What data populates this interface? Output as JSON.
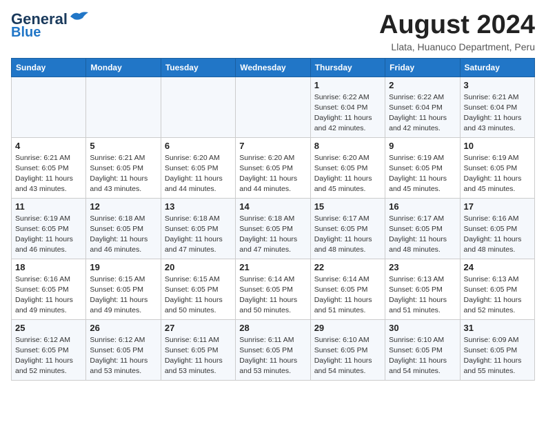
{
  "header": {
    "logo_line1": "General",
    "logo_line2": "Blue",
    "month": "August 2024",
    "location": "Llata, Huanuco Department, Peru"
  },
  "days_of_week": [
    "Sunday",
    "Monday",
    "Tuesday",
    "Wednesday",
    "Thursday",
    "Friday",
    "Saturday"
  ],
  "weeks": [
    [
      {
        "day": "",
        "info": ""
      },
      {
        "day": "",
        "info": ""
      },
      {
        "day": "",
        "info": ""
      },
      {
        "day": "",
        "info": ""
      },
      {
        "day": "1",
        "info": "Sunrise: 6:22 AM\nSunset: 6:04 PM\nDaylight: 11 hours\nand 42 minutes."
      },
      {
        "day": "2",
        "info": "Sunrise: 6:22 AM\nSunset: 6:04 PM\nDaylight: 11 hours\nand 42 minutes."
      },
      {
        "day": "3",
        "info": "Sunrise: 6:21 AM\nSunset: 6:04 PM\nDaylight: 11 hours\nand 43 minutes."
      }
    ],
    [
      {
        "day": "4",
        "info": "Sunrise: 6:21 AM\nSunset: 6:05 PM\nDaylight: 11 hours\nand 43 minutes."
      },
      {
        "day": "5",
        "info": "Sunrise: 6:21 AM\nSunset: 6:05 PM\nDaylight: 11 hours\nand 43 minutes."
      },
      {
        "day": "6",
        "info": "Sunrise: 6:20 AM\nSunset: 6:05 PM\nDaylight: 11 hours\nand 44 minutes."
      },
      {
        "day": "7",
        "info": "Sunrise: 6:20 AM\nSunset: 6:05 PM\nDaylight: 11 hours\nand 44 minutes."
      },
      {
        "day": "8",
        "info": "Sunrise: 6:20 AM\nSunset: 6:05 PM\nDaylight: 11 hours\nand 45 minutes."
      },
      {
        "day": "9",
        "info": "Sunrise: 6:19 AM\nSunset: 6:05 PM\nDaylight: 11 hours\nand 45 minutes."
      },
      {
        "day": "10",
        "info": "Sunrise: 6:19 AM\nSunset: 6:05 PM\nDaylight: 11 hours\nand 45 minutes."
      }
    ],
    [
      {
        "day": "11",
        "info": "Sunrise: 6:19 AM\nSunset: 6:05 PM\nDaylight: 11 hours\nand 46 minutes."
      },
      {
        "day": "12",
        "info": "Sunrise: 6:18 AM\nSunset: 6:05 PM\nDaylight: 11 hours\nand 46 minutes."
      },
      {
        "day": "13",
        "info": "Sunrise: 6:18 AM\nSunset: 6:05 PM\nDaylight: 11 hours\nand 47 minutes."
      },
      {
        "day": "14",
        "info": "Sunrise: 6:18 AM\nSunset: 6:05 PM\nDaylight: 11 hours\nand 47 minutes."
      },
      {
        "day": "15",
        "info": "Sunrise: 6:17 AM\nSunset: 6:05 PM\nDaylight: 11 hours\nand 48 minutes."
      },
      {
        "day": "16",
        "info": "Sunrise: 6:17 AM\nSunset: 6:05 PM\nDaylight: 11 hours\nand 48 minutes."
      },
      {
        "day": "17",
        "info": "Sunrise: 6:16 AM\nSunset: 6:05 PM\nDaylight: 11 hours\nand 48 minutes."
      }
    ],
    [
      {
        "day": "18",
        "info": "Sunrise: 6:16 AM\nSunset: 6:05 PM\nDaylight: 11 hours\nand 49 minutes."
      },
      {
        "day": "19",
        "info": "Sunrise: 6:15 AM\nSunset: 6:05 PM\nDaylight: 11 hours\nand 49 minutes."
      },
      {
        "day": "20",
        "info": "Sunrise: 6:15 AM\nSunset: 6:05 PM\nDaylight: 11 hours\nand 50 minutes."
      },
      {
        "day": "21",
        "info": "Sunrise: 6:14 AM\nSunset: 6:05 PM\nDaylight: 11 hours\nand 50 minutes."
      },
      {
        "day": "22",
        "info": "Sunrise: 6:14 AM\nSunset: 6:05 PM\nDaylight: 11 hours\nand 51 minutes."
      },
      {
        "day": "23",
        "info": "Sunrise: 6:13 AM\nSunset: 6:05 PM\nDaylight: 11 hours\nand 51 minutes."
      },
      {
        "day": "24",
        "info": "Sunrise: 6:13 AM\nSunset: 6:05 PM\nDaylight: 11 hours\nand 52 minutes."
      }
    ],
    [
      {
        "day": "25",
        "info": "Sunrise: 6:12 AM\nSunset: 6:05 PM\nDaylight: 11 hours\nand 52 minutes."
      },
      {
        "day": "26",
        "info": "Sunrise: 6:12 AM\nSunset: 6:05 PM\nDaylight: 11 hours\nand 53 minutes."
      },
      {
        "day": "27",
        "info": "Sunrise: 6:11 AM\nSunset: 6:05 PM\nDaylight: 11 hours\nand 53 minutes."
      },
      {
        "day": "28",
        "info": "Sunrise: 6:11 AM\nSunset: 6:05 PM\nDaylight: 11 hours\nand 53 minutes."
      },
      {
        "day": "29",
        "info": "Sunrise: 6:10 AM\nSunset: 6:05 PM\nDaylight: 11 hours\nand 54 minutes."
      },
      {
        "day": "30",
        "info": "Sunrise: 6:10 AM\nSunset: 6:05 PM\nDaylight: 11 hours\nand 54 minutes."
      },
      {
        "day": "31",
        "info": "Sunrise: 6:09 AM\nSunset: 6:05 PM\nDaylight: 11 hours\nand 55 minutes."
      }
    ]
  ]
}
